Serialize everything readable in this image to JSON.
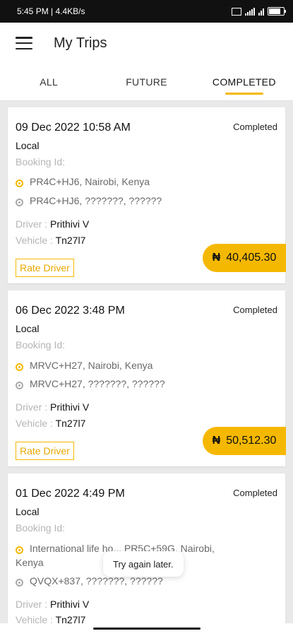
{
  "status_bar": {
    "time_speed": "5:45 PM | 4.4KB/s",
    "network": "4G"
  },
  "appbar": {
    "title": "My Trips",
    "menu_icon": "hamburger-icon"
  },
  "tabs": [
    {
      "label": "ALL",
      "active": false
    },
    {
      "label": "FUTURE",
      "active": false
    },
    {
      "label": "COMPLETED",
      "active": true
    }
  ],
  "trips": [
    {
      "datetime": "09 Dec 2022 10:58 AM",
      "status": "Completed",
      "type": "Local",
      "booking_label": "Booking Id:",
      "pickup": "PR4C+HJ6, Nairobi, Kenya",
      "drop": "PR4C+HJ6, ???????, ??????",
      "driver_label": "Driver : ",
      "driver": "Prithivi V",
      "vehicle_label": "Vehicle : ",
      "vehicle": "Tn27l7",
      "rate_label": "Rate Driver",
      "currency": "₦",
      "amount": "40,405.30"
    },
    {
      "datetime": "06 Dec 2022 3:48 PM",
      "status": "Completed",
      "type": "Local",
      "booking_label": "Booking Id:",
      "pickup": "MRVC+H27, Nairobi, Kenya",
      "drop": "MRVC+H27, ???????, ??????",
      "driver_label": "Driver : ",
      "driver": "Prithivi V",
      "vehicle_label": "Vehicle : ",
      "vehicle": "Tn27l7",
      "rate_label": "Rate Driver",
      "currency": "₦",
      "amount": "50,512.30"
    },
    {
      "datetime": "01 Dec 2022 4:49 PM",
      "status": "Completed",
      "type": "Local",
      "booking_label": "Booking Id:",
      "pickup_line1": "International life ho... PR5C+59G, Nairobi,",
      "pickup_line2": "Kenya",
      "drop": "QVQX+837, ???????, ??????",
      "driver_label": "Driver : ",
      "driver": "Prithivi V",
      "vehicle_label": "Vehicle : ",
      "vehicle": "Tn27l7"
    }
  ],
  "toast": {
    "message": "Try again later."
  },
  "colors": {
    "accent": "#f5b800",
    "background": "#e9e9e9"
  }
}
